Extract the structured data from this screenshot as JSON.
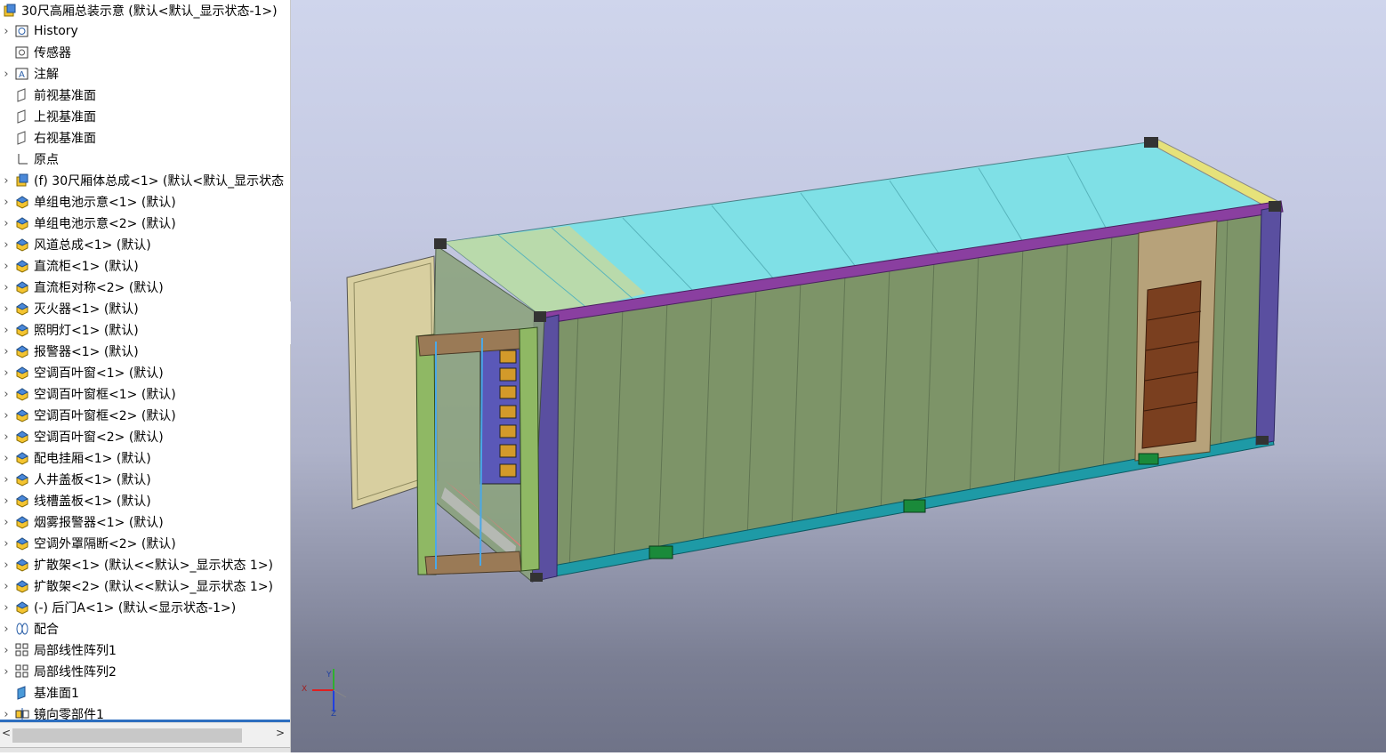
{
  "feature_tree": {
    "root": {
      "label": "30尺高厢总装示意  (默认<默认_显示状态-1>)",
      "icon": "assembly-icon"
    },
    "items": [
      {
        "label": "History",
        "icon": "history-icon",
        "expander": true
      },
      {
        "label": "传感器",
        "icon": "sensor-icon",
        "expander": false
      },
      {
        "label": "注解",
        "icon": "annotation-icon",
        "expander": true
      },
      {
        "label": "前视基准面",
        "icon": "plane-icon",
        "expander": false
      },
      {
        "label": "上视基准面",
        "icon": "plane-icon",
        "expander": false
      },
      {
        "label": "右视基准面",
        "icon": "plane-icon",
        "expander": false
      },
      {
        "label": "原点",
        "icon": "origin-icon",
        "expander": false
      },
      {
        "label": "(f) 30尺厢体总成<1> (默认<默认_显示状态",
        "icon": "subassembly-icon",
        "expander": true
      },
      {
        "label": "单组电池示意<1> (默认)",
        "icon": "part-icon",
        "expander": true
      },
      {
        "label": "单组电池示意<2> (默认)",
        "icon": "part-icon",
        "expander": true
      },
      {
        "label": "风道总成<1> (默认)",
        "icon": "part-icon",
        "expander": true
      },
      {
        "label": "直流柜<1> (默认)",
        "icon": "part-icon",
        "expander": true
      },
      {
        "label": "直流柜对称<2> (默认)",
        "icon": "part-icon",
        "expander": true
      },
      {
        "label": "灭火器<1> (默认)",
        "icon": "part-icon",
        "expander": true
      },
      {
        "label": "照明灯<1> (默认)",
        "icon": "part-icon",
        "expander": true
      },
      {
        "label": "报警器<1> (默认)",
        "icon": "part-icon",
        "expander": true
      },
      {
        "label": "空调百叶窗<1> (默认)",
        "icon": "part-icon",
        "expander": true
      },
      {
        "label": "空调百叶窗框<1> (默认)",
        "icon": "part-icon",
        "expander": true
      },
      {
        "label": "空调百叶窗框<2> (默认)",
        "icon": "part-icon",
        "expander": true
      },
      {
        "label": "空调百叶窗<2> (默认)",
        "icon": "part-icon",
        "expander": true
      },
      {
        "label": "配电挂厢<1> (默认)",
        "icon": "part-icon",
        "expander": true
      },
      {
        "label": "人井盖板<1> (默认)",
        "icon": "part-icon",
        "expander": true
      },
      {
        "label": "线槽盖板<1> (默认)",
        "icon": "part-icon",
        "expander": true
      },
      {
        "label": "烟雾报警器<1> (默认)",
        "icon": "part-icon",
        "expander": true
      },
      {
        "label": "空调外罩隔断<2> (默认)",
        "icon": "part-icon",
        "expander": true
      },
      {
        "label": "扩散架<1> (默认<<默认>_显示状态 1>)",
        "icon": "part-icon",
        "expander": true
      },
      {
        "label": "扩散架<2> (默认<<默认>_显示状态 1>)",
        "icon": "part-icon",
        "expander": true
      },
      {
        "label": "(-) 后门A<1> (默认<显示状态-1>)",
        "icon": "part-icon",
        "expander": true
      },
      {
        "label": "配合",
        "icon": "mates-icon",
        "expander": true
      },
      {
        "label": "局部线性阵列1",
        "icon": "pattern-icon",
        "expander": true
      },
      {
        "label": "局部线性阵列2",
        "icon": "pattern-icon",
        "expander": true
      },
      {
        "label": "基准面1",
        "icon": "plane-feature-icon",
        "expander": false
      },
      {
        "label": "镜向零部件1",
        "icon": "mirror-icon",
        "expander": true
      }
    ]
  },
  "scrollbar": {
    "left_arrow": "<",
    "right_arrow": ">"
  },
  "viewport": {
    "axis_labels": {
      "x": "X",
      "y": "Y",
      "z": "Z"
    },
    "colors": {
      "bg_top": "#cfd5ec",
      "bg_bottom": "#6f7388",
      "container_side": "#7d9468",
      "roof": "#7fe0e6",
      "frame_purple": "#5a4fa0",
      "rail_teal": "#1e9aa6",
      "door": "#d8cfa0",
      "side_door": "#7a3f1f"
    }
  }
}
